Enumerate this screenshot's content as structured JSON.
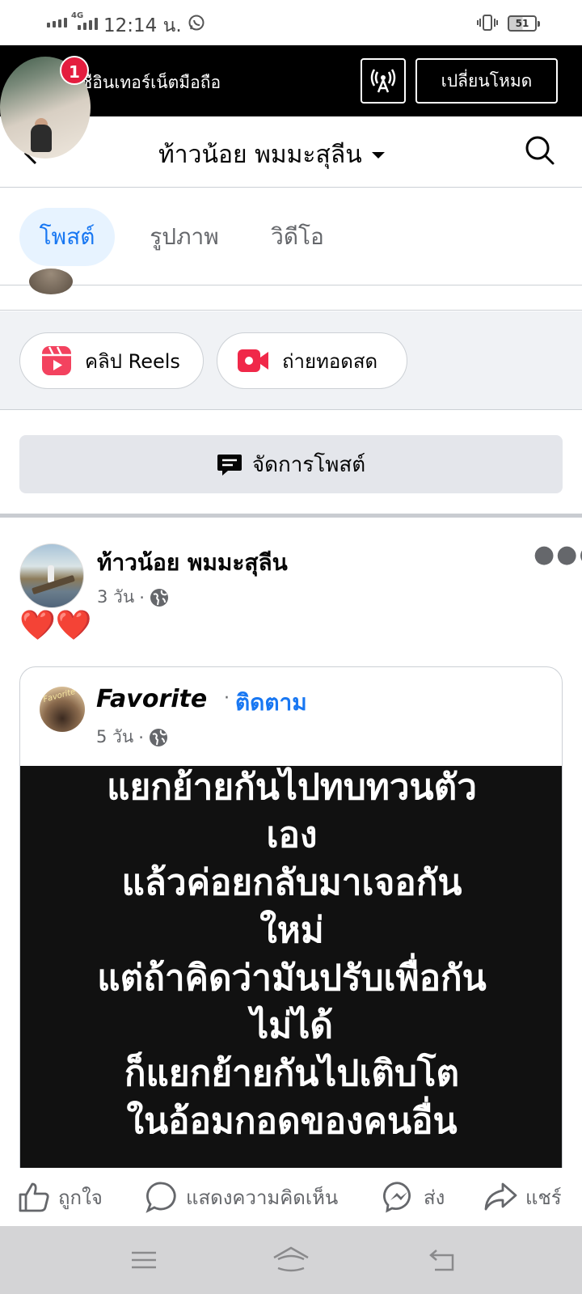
{
  "status_bar": {
    "network": "4G",
    "time": "12:14 น.",
    "battery": "51"
  },
  "free_mode_banner": {
    "text": "ชือินเทอร์เน็ตมือถือ",
    "switch_mode_label": "เปลี่ยนโหมด"
  },
  "chat_head": {
    "badge_count": "1"
  },
  "header": {
    "profile_name": "ท้าวน้อย พมมะสุลีน"
  },
  "tabs": [
    {
      "label": "โพสต์",
      "active": true
    },
    {
      "label": "รูปภาพ",
      "active": false
    },
    {
      "label": "วิดีโอ",
      "active": false
    }
  ],
  "create": {
    "reels_label": "คลิป Reels",
    "live_label": "ถ่ายทอดสด",
    "manage_posts_label": "จัดการโพสต์"
  },
  "post": {
    "author": "ท้าวน้อย พมมะสุลีน",
    "time": "3 วัน",
    "privacy_icon": "globe-icon",
    "text": "❤️❤️",
    "shared": {
      "page_name": "Favorite",
      "avatar_text": "Favorite",
      "follow_label": "ติดตาม",
      "time": "5 วัน",
      "quote_lines": [
        "แยกย้ายกันไปทบทวนตัว",
        "เอง",
        "แล้วค่อยกลับมาเจอกัน",
        "ใหม่",
        "แต่ถ้าคิดว่ามันปรับเพื่อกัน",
        "ไม่ได้",
        "ก็แยกย้ายกันไปเติบโต",
        "ในอ้อมกอดของคนอื่น"
      ]
    }
  },
  "actions": {
    "like": "ถูกใจ",
    "comment": "แสดงความคิดเห็น",
    "send": "ส่ง",
    "share": "แชร์"
  },
  "colors": {
    "accent": "#1877f2",
    "badge": "#e41e3f",
    "reels": "#f3425f",
    "live": "#f02849"
  }
}
